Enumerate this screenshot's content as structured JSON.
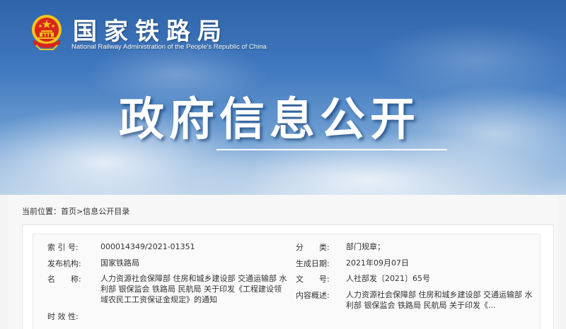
{
  "header": {
    "site_name": "国家铁路局",
    "site_name_en": "National Railway Administration of the People's Republic of China",
    "page_title": "政府信息公开"
  },
  "breadcrumb": {
    "prefix": "当前位置：",
    "home": "首页",
    "separator": ">",
    "current": "信息公开目录"
  },
  "meta": {
    "index_label": "索 引 号:",
    "index_value": "000014349/2021-01351",
    "category_label": "分　　类:",
    "category_value": "部门规章；",
    "publisher_label": "发布机构:",
    "publisher_value": "国家铁路局",
    "date_label": "生成日期:",
    "date_value": "2021年09月07日",
    "name_label": "名　　称:",
    "name_value": "人力资源社会保障部 住房和城乡建设部 交通运输部 水利部 银保监会 铁路局 民航局 关于印发《工程建设领域农民工工资保证金规定》的通知",
    "doc_no_label": "文　　号:",
    "doc_no_value": "人社部发〔2021〕65号",
    "summary_label": "内容概述:",
    "summary_value": "人力资源社会保障部 住房和城乡建设部 交通运输部 水利部 银保监会 铁路局 民航局 关于印发《...",
    "validity_label": "时 效 性:",
    "validity_value": ""
  },
  "colors": {
    "banner_top": "#2f64a9",
    "emblem_red": "#d7261e",
    "emblem_gold": "#f5c518"
  }
}
